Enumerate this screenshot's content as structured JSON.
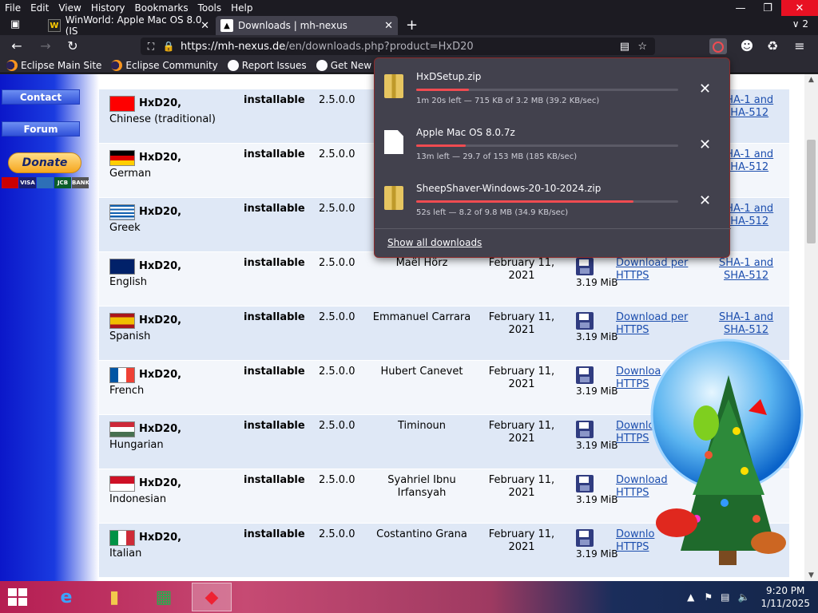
{
  "menubar": {
    "items": [
      "File",
      "Edit",
      "View",
      "History",
      "Bookmarks",
      "Tools",
      "Help"
    ],
    "window_controls": [
      "minimize-icon",
      "restore-icon",
      "close-icon"
    ]
  },
  "tabs": {
    "items": [
      {
        "label": "WinWorld: Apple Mac OS 8.0 (IS",
        "icon": "winworld-icon"
      },
      {
        "label": "Downloads | mh-nexus",
        "icon": "mh-nexus-icon"
      }
    ],
    "count": "2"
  },
  "navbar": {
    "url_domain": "https://mh-nexus.de",
    "url_path": "/en/downloads.php?product=HxD20"
  },
  "bookmarks": [
    "Eclipse Main Site",
    "Eclipse Community",
    "Report Issues",
    "Get New Releases"
  ],
  "sidebar": {
    "contact": "Contact",
    "forum": "Forum",
    "donate": "Donate",
    "cards": [
      "VISA",
      "JCB",
      "BANK"
    ]
  },
  "table": {
    "rows": [
      {
        "flag": "taiwan",
        "product": "HxD20,",
        "language": "Chinese (traditional)",
        "type": "installable",
        "version": "2.5.0.0",
        "author": "",
        "date": "",
        "size": "",
        "link": "",
        "sha1": "SHA-1 and",
        "sha2": "SHA-512"
      },
      {
        "flag": "germany",
        "product": "HxD20,",
        "language": "German",
        "type": "installable",
        "version": "2.5.0.0",
        "author": "",
        "date": "",
        "size": "",
        "link": "",
        "sha1": "SHA-1 and",
        "sha2": "SHA-512"
      },
      {
        "flag": "greece",
        "product": "HxD20,",
        "language": "Greek",
        "type": "installable",
        "version": "2.5.0.0",
        "author": "",
        "date": "",
        "size": "",
        "link": "",
        "sha1": "SHA-1 and",
        "sha2": "SHA-512"
      },
      {
        "flag": "uk",
        "product": "HxD20,",
        "language": "English",
        "type": "installable",
        "version": "2.5.0.0",
        "author": "Maël Hörz",
        "date": "February 11, 2021",
        "size": "3.19 MiB",
        "link1": "Download per",
        "link2": "HTTPS",
        "sha1": "SHA-1 and",
        "sha2": "SHA-512"
      },
      {
        "flag": "spain",
        "product": "HxD20,",
        "language": "Spanish",
        "type": "installable",
        "version": "2.5.0.0",
        "author": "Emmanuel Carrara",
        "date": "February 11, 2021",
        "size": "3.19 MiB",
        "link1": "Download per",
        "link2": "HTTPS",
        "sha1": "SHA-1 and",
        "sha2": "SHA-512"
      },
      {
        "flag": "france",
        "product": "HxD20,",
        "language": "French",
        "type": "installable",
        "version": "2.5.0.0",
        "author": "Hubert Canevet",
        "date": "February 11, 2021",
        "size": "3.19 MiB",
        "link1": "Downloa",
        "link2": "HTTPS",
        "sha1": "",
        "sha2": ""
      },
      {
        "flag": "hungary",
        "product": "HxD20,",
        "language": "Hungarian",
        "type": "installable",
        "version": "2.5.0.0",
        "author": "Timinoun",
        "date": "February 11, 2021",
        "size": "3.19 MiB",
        "link1": "Downlo",
        "link2": "HTTPS",
        "sha1": "",
        "sha2": ""
      },
      {
        "flag": "indonesia",
        "product": "HxD20,",
        "language": "Indonesian",
        "type": "installable",
        "version": "2.5.0.0",
        "author": "Syahriel Ibnu Irfansyah",
        "date": "February 11, 2021",
        "size": "3.19 MiB",
        "link1": "Download",
        "link2": "HTTPS",
        "sha1": "",
        "sha2": ""
      },
      {
        "flag": "italy",
        "product": "HxD20,",
        "language": "Italian",
        "type": "installable",
        "version": "2.5.0.0",
        "author": "Costantino Grana",
        "date": "February 11, 2021",
        "size": "3.19 MiB",
        "link1": "Downlo",
        "link2": "HTTPS",
        "sha1": "",
        "sha2": ""
      }
    ]
  },
  "downloads_panel": {
    "items": [
      {
        "name": "HxDSetup.zip",
        "status": "1m 20s left — 715 KB of 3.2 MB (39.2 KB/sec)",
        "progress": 0.2,
        "icon": "zip-folder-icon"
      },
      {
        "name": "Apple Mac OS 8.0.7z",
        "status": "13m left — 29.7 of 153 MB (185 KB/sec)",
        "progress": 0.19,
        "icon": "file-icon"
      },
      {
        "name": "SheepShaver-Windows-20-10-2024.zip",
        "status": "52s left — 8.2 of 9.8 MB (34.9 KB/sec)",
        "progress": 0.83,
        "icon": "zip-folder-icon"
      }
    ],
    "show_all": "Show all downloads"
  },
  "taskbar": {
    "apps": [
      "internet-explorer-icon",
      "file-explorer-icon",
      "store-icon",
      "app-icon"
    ],
    "time": "9:20 PM",
    "date": "1/11/2025"
  },
  "colors": {
    "accent_progress": "#f04b51",
    "link": "#1c4eae",
    "row_odd": "#dfe8f6",
    "row_even": "#f3f6fb"
  }
}
